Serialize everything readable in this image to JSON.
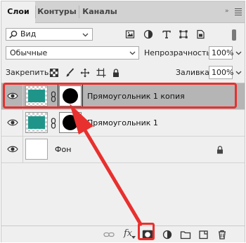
{
  "tabs": [
    {
      "label": "Слои",
      "active": true
    },
    {
      "label": "Контуры",
      "active": false
    },
    {
      "label": "Каналы",
      "active": false
    }
  ],
  "filter": {
    "value": "Вид"
  },
  "blend": {
    "mode": "Обычные",
    "opacity_label": "Непрозрачность:",
    "opacity_value": "100%"
  },
  "lock": {
    "label": "Закрепить:",
    "fill_label": "Заливка:",
    "fill_value": "100%"
  },
  "layers": [
    {
      "name": "Прямоугольник 1 копия",
      "selected": true,
      "visible": true,
      "thumb_color": "#1f958a",
      "has_mask": true
    },
    {
      "name": "Прямоугольник 1",
      "selected": false,
      "visible": true,
      "thumb_color": "#1f958a",
      "has_mask": true
    },
    {
      "name": "Фон",
      "selected": false,
      "visible": true,
      "locked": true
    }
  ],
  "bottom_bar": {
    "fx_label": "fx"
  },
  "colors": {
    "annotation": "#e8302e",
    "accent": "#1f958a",
    "selected_row": "#b5b5b5"
  }
}
